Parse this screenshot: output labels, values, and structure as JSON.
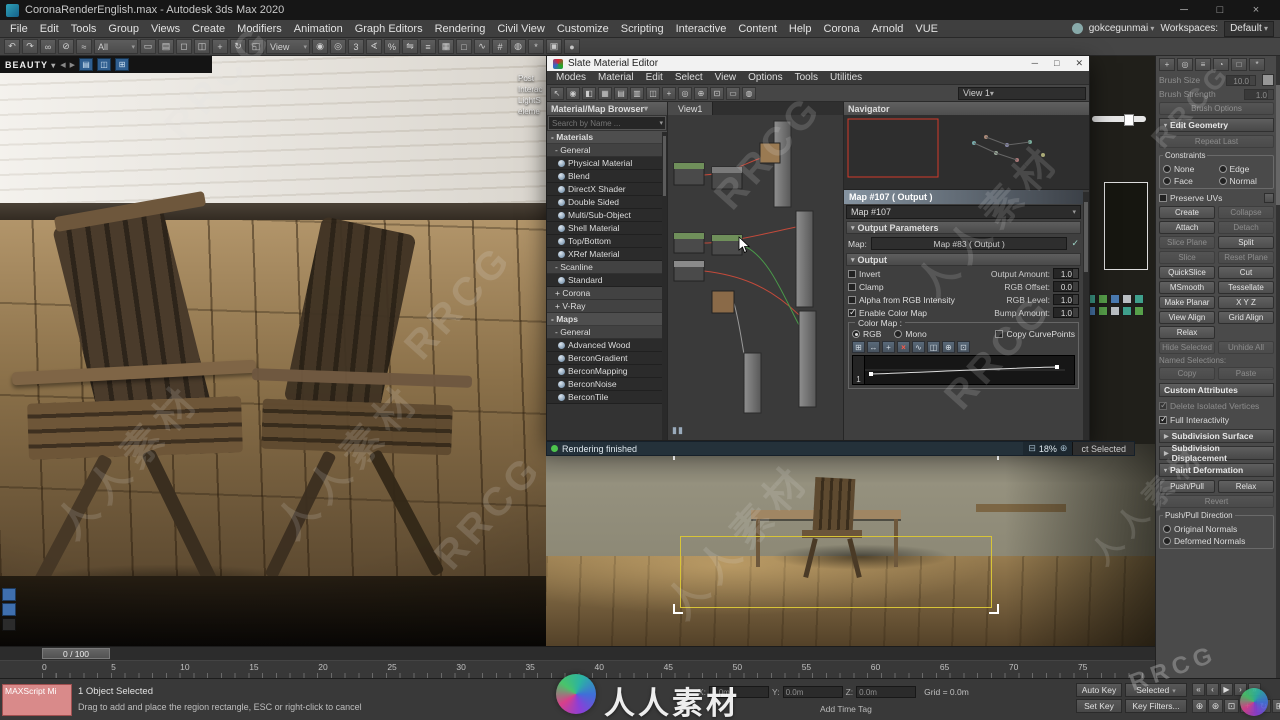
{
  "titlebar": {
    "title": "CoronaRenderEnglish.max - Autodesk 3ds Max 2020"
  },
  "menubar": {
    "items": [
      "File",
      "Edit",
      "Tools",
      "Group",
      "Views",
      "Create",
      "Modifiers",
      "Animation",
      "Graph Editors",
      "Rendering",
      "Civil View",
      "Customize",
      "Scripting",
      "Interactive",
      "Content",
      "Help",
      "Corona",
      "Arnold",
      "VUE"
    ],
    "user": "gokcegunmai",
    "workspaces_label": "Workspaces:",
    "workspace_value": "Default"
  },
  "toolbar": {
    "icons": [
      {
        "name": "undo-icon",
        "glyph": "↶"
      },
      {
        "name": "redo-icon",
        "glyph": "↷"
      },
      {
        "name": "select-link-icon",
        "glyph": "∞"
      },
      {
        "name": "unlink-icon",
        "glyph": "⊘"
      },
      {
        "name": "bind-spacewarp-icon",
        "glyph": "≈"
      },
      {
        "name": "selection-filter-dropdown",
        "glyph": "All",
        "cls": "drop"
      },
      {
        "name": "select-object-icon",
        "glyph": "▭"
      },
      {
        "name": "select-by-name-icon",
        "glyph": "▤"
      },
      {
        "name": "rectangular-region-icon",
        "glyph": "◻"
      },
      {
        "name": "window-crossing-icon",
        "glyph": "◫"
      },
      {
        "name": "select-move-icon",
        "glyph": "+"
      },
      {
        "name": "select-rotate-icon",
        "glyph": "↻"
      },
      {
        "name": "select-scale-icon",
        "glyph": "◱"
      },
      {
        "name": "reference-coordinate-dropdown",
        "glyph": "View",
        "cls": "drop"
      },
      {
        "name": "use-pivot-center-icon",
        "glyph": "◉"
      },
      {
        "name": "select-manipulate-icon",
        "glyph": "◎"
      },
      {
        "name": "snap-toggle-icon",
        "glyph": "3"
      },
      {
        "name": "angle-snap-icon",
        "glyph": "∢"
      },
      {
        "name": "percent-snap-icon",
        "glyph": "%"
      },
      {
        "name": "mirror-icon",
        "glyph": "⇋"
      },
      {
        "name": "align-icon",
        "glyph": "≡"
      },
      {
        "name": "scene-explorer-icon",
        "glyph": "▦"
      },
      {
        "name": "layer-explorer-icon",
        "glyph": "□"
      },
      {
        "name": "curve-editor-icon",
        "glyph": "∿"
      },
      {
        "name": "schematic-view-icon",
        "glyph": "#"
      },
      {
        "name": "material-editor-icon",
        "glyph": "◍"
      },
      {
        "name": "render-setup-icon",
        "glyph": "*"
      },
      {
        "name": "rendered-frame-icon",
        "glyph": "▣"
      },
      {
        "name": "render-production-icon",
        "glyph": "●"
      }
    ]
  },
  "vfb": {
    "channel": "BEAUTY",
    "side_labels": [
      "Post",
      "Interac",
      "LightS",
      "eleme"
    ]
  },
  "slate": {
    "title": "Slate Material Editor",
    "menus": [
      "Modes",
      "Material",
      "Edit",
      "Select",
      "View",
      "Options",
      "Tools",
      "Utilities"
    ],
    "toolbar_icons": [
      {
        "name": "select-tool-icon",
        "glyph": "↖"
      },
      {
        "name": "pick-material-icon",
        "glyph": "◉"
      },
      {
        "name": "show-shaded-icon",
        "glyph": "◧"
      },
      {
        "name": "show-background-icon",
        "glyph": "▦"
      },
      {
        "name": "layout-all-icon",
        "glyph": "▤"
      },
      {
        "name": "layout-children-icon",
        "glyph": "▥"
      },
      {
        "name": "hide-unused-nodeslots-icon",
        "glyph": "◫"
      },
      {
        "name": "move-children-icon",
        "glyph": "+"
      },
      {
        "name": "pan-tool-icon",
        "glyph": "◎"
      },
      {
        "name": "zoom-tool-icon",
        "glyph": "⊕"
      },
      {
        "name": "zoom-extents-icon",
        "glyph": "⊡"
      },
      {
        "name": "zoom-region-icon",
        "glyph": "▭"
      },
      {
        "name": "preview-icon",
        "glyph": "◍"
      }
    ],
    "view_selector": "View 1",
    "view_tab": "View1",
    "browser_title": "Material/Map Browser",
    "search_placeholder": "Search by Name ...",
    "browser_items": [
      {
        "label": "- Materials",
        "kind": "group"
      },
      {
        "label": "- General",
        "kind": "sub"
      },
      {
        "label": "Physical Material",
        "kind": "item"
      },
      {
        "label": "Blend",
        "kind": "item"
      },
      {
        "label": "DirectX Shader",
        "kind": "item"
      },
      {
        "label": "Double Sided",
        "kind": "item"
      },
      {
        "label": "Multi/Sub-Object",
        "kind": "item"
      },
      {
        "label": "Shell Material",
        "kind": "item"
      },
      {
        "label": "Top/Bottom",
        "kind": "item"
      },
      {
        "label": "XRef Material",
        "kind": "item"
      },
      {
        "label": "- Scanline",
        "kind": "sub"
      },
      {
        "label": "Standard",
        "kind": "item"
      },
      {
        "label": "+ Corona",
        "kind": "sub"
      },
      {
        "label": "+ V-Ray",
        "kind": "sub"
      },
      {
        "label": "- Maps",
        "kind": "group"
      },
      {
        "label": "- General",
        "kind": "sub"
      },
      {
        "label": "Advanced Wood",
        "kind": "item"
      },
      {
        "label": "BerconGradient",
        "kind": "item"
      },
      {
        "label": "BerconMapping",
        "kind": "item"
      },
      {
        "label": "BerconNoise",
        "kind": "item"
      },
      {
        "label": "BerconTile",
        "kind": "item"
      }
    ],
    "navigator_title": "Navigator",
    "params_title": "Map #107  ( Output )",
    "param_name": "Map #107",
    "rollout_output_params": "Output Parameters",
    "map_label": "Map:",
    "map_button": "Map #83  ( Output )",
    "rollout_output": "Output",
    "output_rows": [
      {
        "check": "Invert",
        "state": "un",
        "spin": "Output Amount:",
        "value": "1.0"
      },
      {
        "check": "Clamp",
        "state": "un",
        "spin": "RGB Offset:",
        "value": "0.0"
      },
      {
        "check": "Alpha from RGB Intensity",
        "state": "un",
        "spin": "RGB Level:",
        "value": "1.0"
      },
      {
        "check": "Enable Color Map",
        "state": "checked",
        "spin": "Bump Amount:",
        "value": "1.0"
      }
    ],
    "color_map_label": "Color Map :",
    "rgb_label": "RGB",
    "mono_label": "Mono",
    "copy_curvepoints_label": "Copy CurvePoints",
    "curve_icons": [
      {
        "name": "move-point-icon",
        "glyph": "⊞"
      },
      {
        "name": "scale-point-icon",
        "glyph": "↔"
      },
      {
        "name": "add-point-icon",
        "glyph": "+"
      },
      {
        "name": "delete-point-icon",
        "glyph": "×",
        "cls": "red"
      },
      {
        "name": "reset-curve-icon",
        "glyph": "∿"
      },
      {
        "name": "pan-curve-icon",
        "glyph": "◫"
      },
      {
        "name": "zoom-curve-icon",
        "glyph": "⊕"
      },
      {
        "name": "fit-curve-icon",
        "glyph": "⊡"
      }
    ],
    "curve_row_label": "1",
    "status": "Rendering finished",
    "zoom_level": "18%",
    "status_selected": "ct Selected"
  },
  "command_panel": {
    "tabs": [
      {
        "name": "tab-create",
        "glyph": "+"
      },
      {
        "name": "tab-modify",
        "glyph": "◎"
      },
      {
        "name": "tab-hierarchy",
        "glyph": "≡"
      },
      {
        "name": "tab-motion",
        "glyph": "◔"
      },
      {
        "name": "tab-display",
        "glyph": "□"
      },
      {
        "name": "tab-utilities",
        "glyph": "*"
      }
    ],
    "brush_size_label": "Brush Size",
    "brush_size_value": "10.0",
    "brush_strength_label": "Brush Strength",
    "brush_strength_value": "1.0",
    "brush_options_label": "Brush Options",
    "edit_geometry_title": "Edit Geometry",
    "repeat_last": "Repeat Last",
    "constraints_label": "Constraints",
    "constraints": [
      "None",
      "Edge",
      "Face",
      "Normal"
    ],
    "preserve_uvs": "Preserve UVs",
    "button_rows": [
      {
        "l": "Create",
        "r": "Collapse",
        "lc": "on",
        "rc": "off"
      },
      {
        "l": "Attach",
        "r": "Detach",
        "lc": "on",
        "rc": "off"
      },
      {
        "l": "Slice Plane",
        "r": "Split",
        "lc": "off",
        "rc": "on"
      },
      {
        "l": "Slice",
        "r": "Reset Plane",
        "lc": "off",
        "rc": "off"
      },
      {
        "l": "QuickSlice",
        "r": "Cut",
        "lc": "on",
        "rc": "on"
      },
      {
        "l": "MSmooth",
        "r": "Tessellate",
        "lc": "on",
        "rc": "on"
      },
      {
        "l": "Make Planar",
        "r": "X  Y  Z",
        "lc": "on",
        "rc": "on"
      },
      {
        "l": "View Align",
        "r": "Grid Align",
        "lc": "on",
        "rc": "on"
      },
      {
        "l": "Relax",
        "r": "",
        "lc": "on",
        "rc": "hide"
      },
      {
        "l": "Hide Selected",
        "r": "Unhide All",
        "lc": "off",
        "rc": "off"
      }
    ],
    "named_selections_label": "Named Selections:",
    "copy_label": "Copy",
    "paste_label": "Paste",
    "custom_attributes_title": "Custom Attributes",
    "delete_isolated": "Delete Isolated Vertices",
    "full_interactivity": "Full Interactivity",
    "rollout_subdivision_surface": "Subdivision Surface",
    "rollout_subdivision_displacement": "Subdivision Displacement",
    "rollout_paint_deformation": "Paint Deformation",
    "paint": {
      "push_pull": "Push/Pull",
      "relax": "Relax",
      "revert": "Revert",
      "direction_label": "Push/Pull Direction",
      "options": [
        "Original Normals",
        "Deformed Normals"
      ]
    }
  },
  "timeline": {
    "slider_label": "0 / 100",
    "ticks": [
      "0",
      "5",
      "10",
      "15",
      "20",
      "25",
      "30",
      "35",
      "40",
      "45",
      "50",
      "55",
      "60",
      "65",
      "70",
      "75"
    ]
  },
  "statusbar": {
    "maxscript_label": "MAXScript Mi",
    "selection_status": "1 Object Selected",
    "prompt": "Drag to add and place the region rectangle, ESC or right-click to cancel",
    "coords": {
      "x_label": "X:",
      "x_value": "0.0m",
      "y_label": "Y:",
      "y_value": "0.0m",
      "z_label": "Z:",
      "z_value": "0.0m"
    },
    "grid": "Grid = 0.0m",
    "add_time_tag": "Add Time Tag",
    "auto_key": "Auto Key",
    "selection_set": "Selected",
    "set_key": "Set Key",
    "key_filters": "Key Filters...",
    "playback": [
      {
        "name": "go-to-start-button",
        "glyph": "«"
      },
      {
        "name": "previous-frame-button",
        "glyph": "‹"
      },
      {
        "name": "play-button",
        "glyph": "▶"
      },
      {
        "name": "next-frame-button",
        "glyph": "›"
      },
      {
        "name": "go-to-end-button",
        "glyph": "»"
      }
    ],
    "nav_icons": [
      {
        "name": "zoom-button",
        "glyph": "⊕"
      },
      {
        "name": "zoom-all-button",
        "glyph": "⊛"
      },
      {
        "name": "zoom-extents-button",
        "glyph": "⊡"
      },
      {
        "name": "pan-button",
        "glyph": "+"
      },
      {
        "name": "orbit-button",
        "glyph": "↻"
      },
      {
        "name": "maximize-viewport-button",
        "glyph": "⊞"
      }
    ]
  },
  "watermark": {
    "brand_rrcg": "RRCG",
    "brand_renren": "人人素材"
  }
}
